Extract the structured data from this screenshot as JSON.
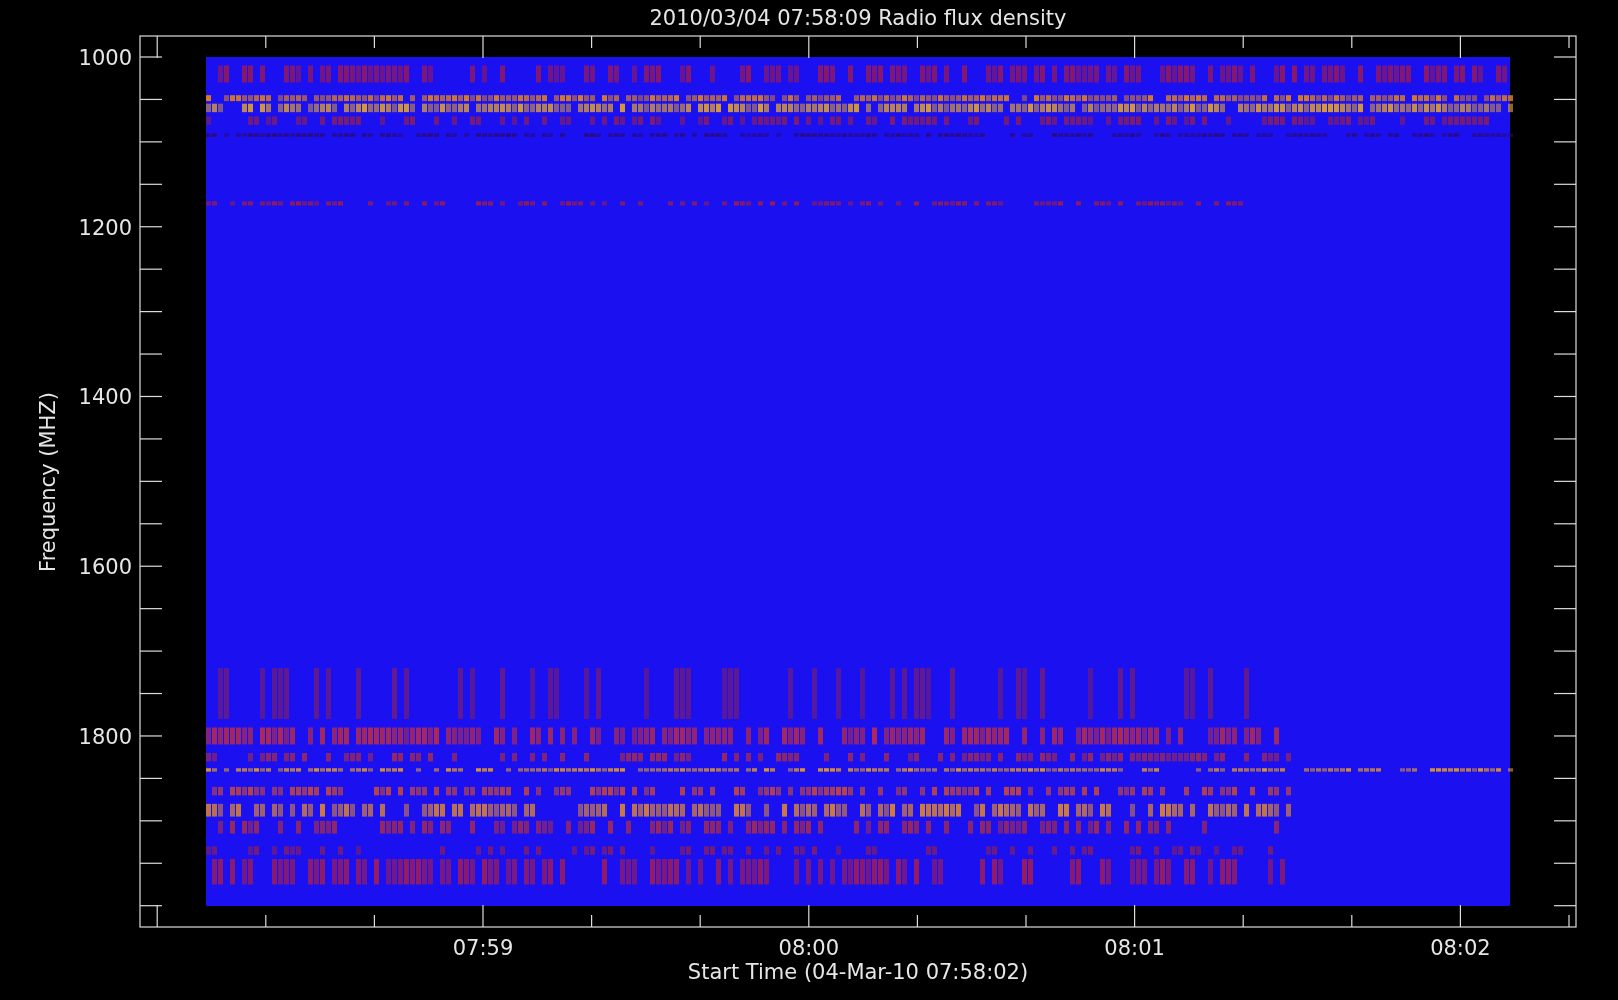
{
  "title": "2010/03/04 07:58:09 Radio flux density",
  "y_axis": {
    "label": "Frequency (MHZ)",
    "tick_labels": [
      "1000",
      "1200",
      "1400",
      "1600",
      "1800"
    ]
  },
  "x_axis": {
    "label": "Start Time (04-Mar-10 07:58:02)",
    "tick_labels": [
      "07:59",
      "08:00",
      "08:01",
      "08:02"
    ]
  }
}
